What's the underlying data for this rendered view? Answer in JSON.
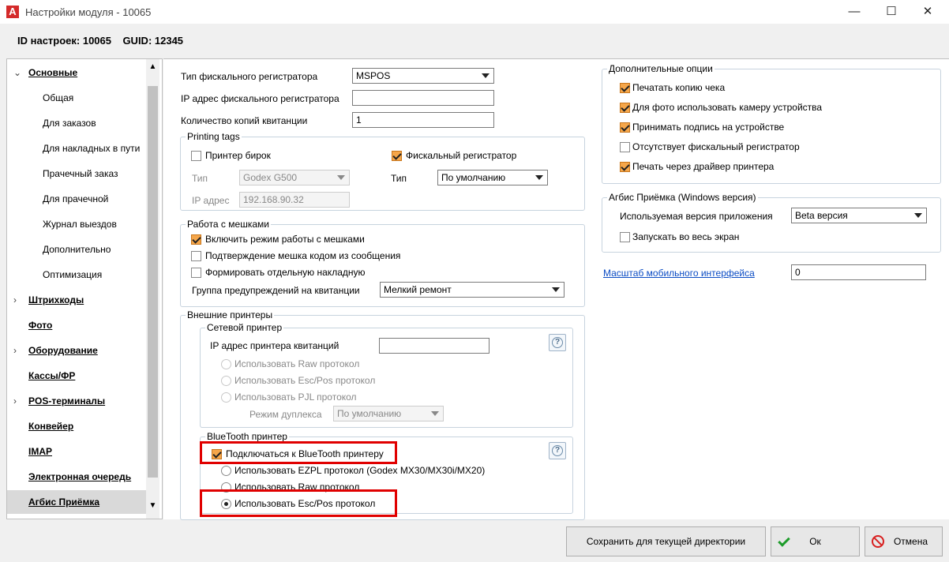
{
  "window": {
    "title": "Настройки модуля - 10065",
    "logo_letter": "A",
    "minimize_icon": "—",
    "maximize_icon": "☐",
    "close_icon": "✕"
  },
  "info_line": "ID настроек: 10065    GUID: 12345",
  "sidebar": {
    "items": [
      {
        "label": "Основные",
        "chevron": "⌄"
      },
      {
        "label": "Общая"
      },
      {
        "label": "Для заказов"
      },
      {
        "label": "Для накладных в пути"
      },
      {
        "label": "Прачечный заказ"
      },
      {
        "label": "Для прачечной"
      },
      {
        "label": "Журнал выездов"
      },
      {
        "label": "Дополнительно"
      },
      {
        "label": "Оптимизация"
      },
      {
        "label": "Штрихкоды",
        "chevron": "›"
      },
      {
        "label": "Фото"
      },
      {
        "label": "Оборудование",
        "chevron": "›"
      },
      {
        "label": "Кассы/ФР"
      },
      {
        "label": "POS-терминалы",
        "chevron": "›"
      },
      {
        "label": "Конвейер"
      },
      {
        "label": "IMAP"
      },
      {
        "label": "Электронная очередь"
      },
      {
        "label": "Агбис Приёмка"
      }
    ],
    "scroll_up": "▲",
    "scroll_down": "▼"
  },
  "fiscal": {
    "type_label": "Тип фискального регистратора",
    "type_value": "MSPOS",
    "ip_label": "IP адрес фискального регистратора",
    "ip_value": "",
    "copies_label": "Количество копий квитанции",
    "copies_value": "1"
  },
  "printing_tags": {
    "title": "Printing tags",
    "tag_printer_label": "Принтер бирок",
    "type_label": "Тип",
    "type_value": "Godex G500",
    "ip_label": "IP адрес",
    "ip_value": "192.168.90.32",
    "fiscal_reg_label": "Фискальный регистратор",
    "fiscal_type_label": "Тип",
    "fiscal_type_value": "По умолчанию"
  },
  "bags": {
    "title": "Работа с мешками",
    "enable_label": "Включить режим работы с мешками",
    "confirm_label": "Подтверждение мешка кодом из сообщения",
    "separate_label": "Формировать отдельную накладную",
    "warn_group_label": "Группа предупреждений на квитанции",
    "warn_group_value": "Мелкий ремонт"
  },
  "external": {
    "title": "Внешние принтеры",
    "network": {
      "title": "Сетевой принтер",
      "ip_label": "IP адрес принтера квитанций",
      "ip_value": "",
      "raw_label": "Использовать Raw протокол",
      "escpos_label": "Использовать Esc/Pos протокол",
      "pjl_label": "Использовать PJL протокол",
      "duplex_label": "Режим дуплекса",
      "duplex_value": "По умолчанию",
      "help": "?"
    },
    "bluetooth": {
      "title": "BlueTooth принтер",
      "connect_label": "Подключаться к BlueTooth принтеру",
      "ezpl_label": "Использовать EZPL протокол (Godex MX30/MX30i/MX20)",
      "raw_label": "Использовать Raw протокол",
      "escpos_label": "Использовать Esc/Pos протокол",
      "help": "?"
    }
  },
  "options": {
    "title": "Дополнительные опции",
    "items": [
      {
        "label": "Печатать копию чека",
        "checked": true
      },
      {
        "label": "Для фото использовать камеру устройства",
        "checked": true
      },
      {
        "label": "Принимать подпись на устройстве",
        "checked": true
      },
      {
        "label": "Отсутствует фискальный регистратор",
        "checked": false
      },
      {
        "label": "Печать через драйвер принтера",
        "checked": true
      }
    ]
  },
  "agbis": {
    "title": "Агбис Приёмка (Windows версия)",
    "version_label": "Используемая версия приложения",
    "version_value": "Beta версия",
    "fullscreen_label": "Запускать во весь экран"
  },
  "mobile_scale": {
    "label": "Масштаб мобильного интерфейса",
    "value": "0"
  },
  "footer": {
    "save_label": "Сохранить для текущей директории",
    "ok_label": "Ок",
    "cancel_label": "Отмена"
  },
  "colors": {
    "checkbox_checked": "#f5a64a",
    "highlight": "#e00000",
    "link": "#0b4cc4"
  }
}
